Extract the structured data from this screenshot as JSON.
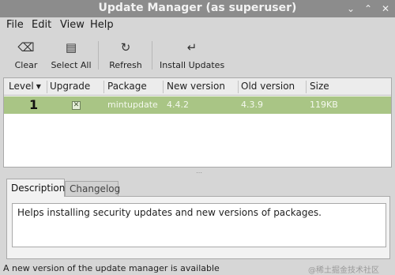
{
  "window": {
    "title": "Update Manager (as superuser)",
    "minimize_glyph": "⌄",
    "maximize_glyph": "⌃",
    "close_glyph": "✕"
  },
  "menu": {
    "file": "File",
    "edit": "Edit",
    "view": "View",
    "help": "Help"
  },
  "toolbar": {
    "clear": {
      "label": "Clear",
      "icon": "backspace-icon",
      "glyph": "⌫"
    },
    "select_all": {
      "label": "Select All",
      "icon": "document-icon",
      "glyph": "▤"
    },
    "refresh": {
      "label": "Refresh",
      "icon": "refresh-icon",
      "glyph": "↻"
    },
    "install": {
      "label": "Install Updates",
      "icon": "enter-arrow-icon",
      "glyph": "↵"
    }
  },
  "table": {
    "columns": [
      "Level",
      "Upgrade",
      "Package",
      "New version",
      "Old version",
      "Size"
    ],
    "sort_glyph": "▼",
    "rows": [
      {
        "level": "1",
        "upgrade_checked": true,
        "check_glyph": "✕",
        "package": "mintupdate",
        "new_version": "4.4.2",
        "old_version": "4.3.9",
        "size": "119KB"
      }
    ]
  },
  "splitter_glyph": "⋯",
  "tabs": {
    "description": "Description",
    "changelog": "Changelog"
  },
  "description_text": "Helps installing security updates and new versions of packages.",
  "status": {
    "message": "A new version of the update manager is available"
  },
  "watermark": "@稀土掘金技术社区",
  "colors": {
    "selected_row": "#a9c585",
    "titlebar": "#8c8c8c"
  }
}
